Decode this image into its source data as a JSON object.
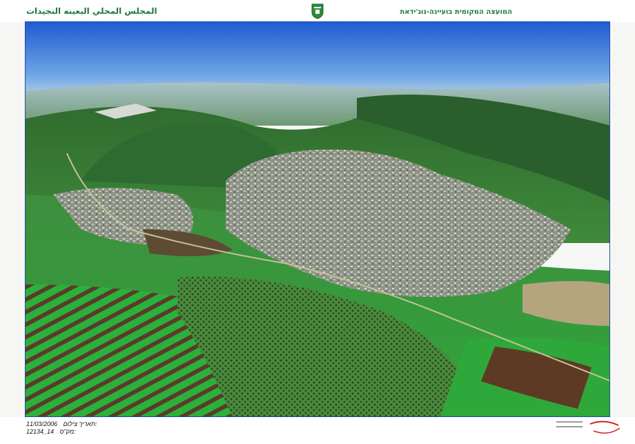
{
  "header": {
    "arabic_title": "المجلس المحلي البعينه النجيدات",
    "hebrew_title": "המועצה המקומית בועיינה-נוג'ידאת",
    "emblem_icon": "council-emblem-icon"
  },
  "photo": {
    "description_icon": "aerial-village-photo",
    "sky_color": "#2f6fd8",
    "field_color": "#2fae3a"
  },
  "footer": {
    "date_value": "11/03/2006",
    "date_label": "תאריך צילום:",
    "number_value": "12134_14",
    "number_label": "מק\"ס:",
    "phone_line_1": "",
    "phone_line_2": "",
    "logo_icon": "photographer-logo-icon"
  }
}
